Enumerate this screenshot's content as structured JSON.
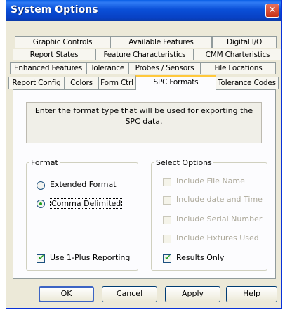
{
  "window": {
    "title": "System Options",
    "close_glyph": "✕"
  },
  "tabs": {
    "row1": [
      "Graphic Controls",
      "Available Features",
      "Digital I/O"
    ],
    "row2": [
      "Report States",
      "Feature Characteristics",
      "CMM Charteristics"
    ],
    "row3": [
      "Enhanced Features",
      "Tolerance",
      "Probes / Sensors",
      "File Locations"
    ],
    "row4": [
      "Report Config",
      "Colors",
      "Form Ctrl",
      "SPC Formats",
      "Tolerance Codes"
    ],
    "active": "SPC Formats"
  },
  "instructions": "Enter the format type that will be used for exporting the SPC data.",
  "format": {
    "legend": "Format",
    "options": [
      {
        "label": "Extended Format",
        "selected": false
      },
      {
        "label": "Comma Delimited",
        "selected": true
      }
    ],
    "one_plus": {
      "label": "Use 1-Plus Reporting",
      "checked": true
    }
  },
  "select_options": {
    "legend": "Select Options",
    "items": [
      {
        "label": "Include File Name",
        "checked": false,
        "enabled": false
      },
      {
        "label": "Include date and Time",
        "checked": false,
        "enabled": false
      },
      {
        "label": "Include Serial Number",
        "checked": false,
        "enabled": false
      },
      {
        "label": "Include Fixtures Used",
        "checked": false,
        "enabled": false
      },
      {
        "label": "Results Only",
        "checked": true,
        "enabled": true
      }
    ]
  },
  "buttons": {
    "ok": "OK",
    "cancel": "Cancel",
    "apply": "Apply",
    "help": "Help"
  },
  "colors": {
    "title_bar": "#0a4fd8",
    "window_face": "#ece9d8",
    "active_tab_highlight": "#ffc83c",
    "check_mark": "#21a121"
  }
}
